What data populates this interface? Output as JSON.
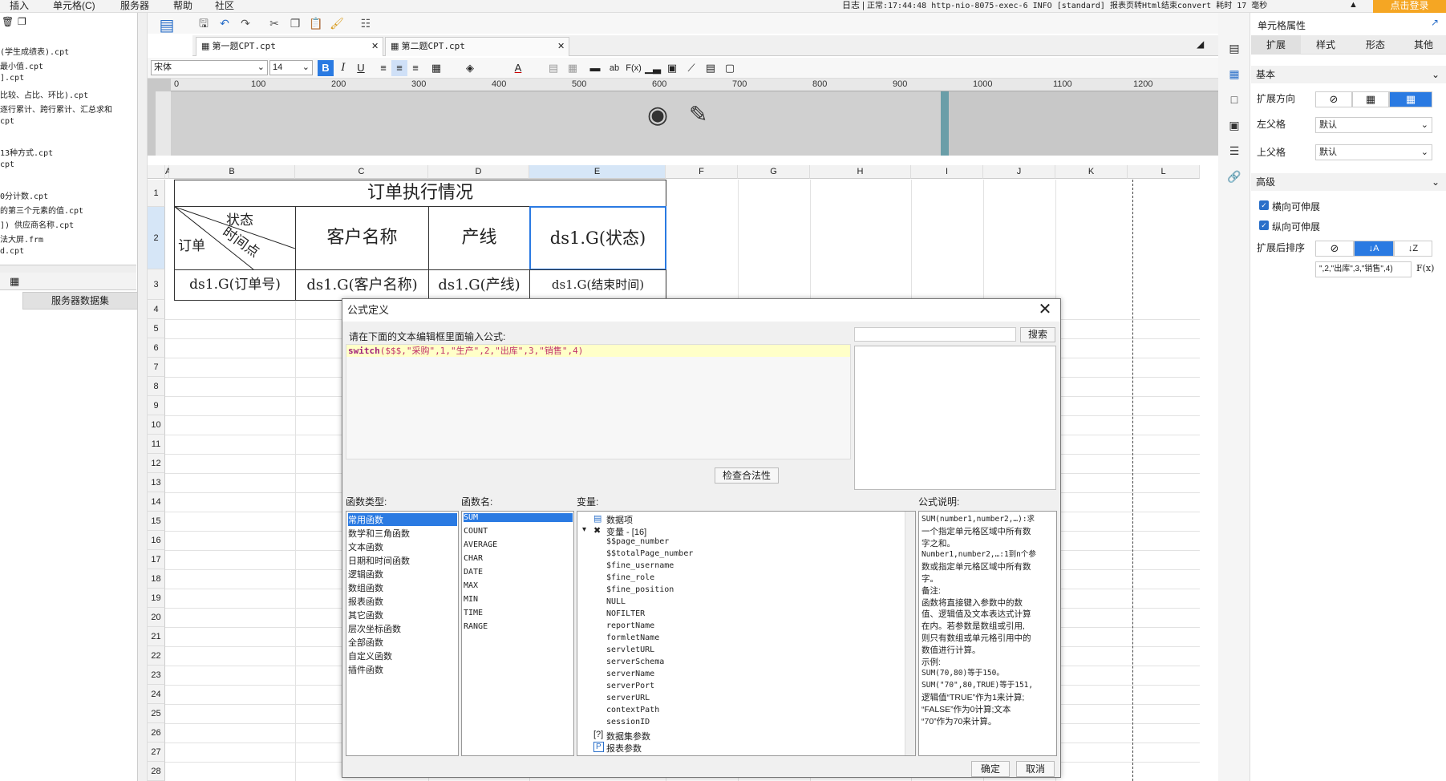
{
  "menu": {
    "items": [
      "插入",
      "单元格(C)",
      "服务器",
      "帮助",
      "社区"
    ]
  },
  "status": {
    "log_label": "日志",
    "log_text": "正常:17:44:48 http-nio-8075-exec-6 INFO [standard] 报表页转Html结束convert 耗时 17 毫秒",
    "login": "点击登录"
  },
  "left_panel": {
    "files": [
      "(学生成绩表).cpt",
      "最小值.cpt",
      "].cpt",
      "比较、占比、环比).cpt",
      "逐行累计、跨行累计、汇总求和",
      "cpt",
      "",
      "13种方式.cpt",
      "cpt",
      "",
      "0分计数.cpt",
      "的第三个元素的值.cpt",
      "]) 供应商名称.cpt",
      "法大屏.frm",
      "d.cpt"
    ],
    "datasource_button": "服务器数据集"
  },
  "tabs": [
    {
      "label": "第一题CPT.cpt"
    },
    {
      "label": "第二题CPT.cpt"
    }
  ],
  "format_toolbar": {
    "font": "宋体",
    "size": "14"
  },
  "ruler": [
    "0",
    "100",
    "200",
    "300",
    "400",
    "500",
    "600",
    "700",
    "800",
    "900",
    "1000",
    "1100",
    "1200"
  ],
  "columns": [
    "A",
    "B",
    "C",
    "D",
    "E",
    "F",
    "G",
    "H",
    "I",
    "J",
    "K",
    "L"
  ],
  "rows": [
    "1",
    "2",
    "3",
    "4",
    "5",
    "6",
    "7",
    "8",
    "9",
    "10",
    "11",
    "12",
    "13",
    "14",
    "15",
    "16",
    "17",
    "18",
    "19",
    "20",
    "21",
    "22",
    "23",
    "24",
    "25",
    "26",
    "27",
    "28"
  ],
  "report": {
    "title": "订单执行情况",
    "diag_state": "状态",
    "diag_time": "时间点",
    "diag_order": "订单",
    "h_customer": "客户名称",
    "h_line": "产线",
    "h_state": "ds1.G(状态)",
    "r_order": "ds1.G(订单号)",
    "r_customer": "ds1.G(客户名称)",
    "r_line": "ds1.G(产线)",
    "r_end": "ds1.G(结束时间)"
  },
  "right_panel": {
    "title": "单元格属性",
    "tabs": [
      "扩展",
      "样式",
      "形态",
      "其他"
    ],
    "basic": "基本",
    "expand_dir": "扩展方向",
    "left_parent": "左父格",
    "left_parent_val": "默认",
    "up_parent": "上父格",
    "up_parent_val": "默认",
    "advanced": "高级",
    "h_expand": "横向可伸展",
    "v_expand": "纵向可伸展",
    "sort_after": "扩展后排序",
    "formula_preview": "\",2,\"出库\",3,\"销售\",4)",
    "fx": "F(x)"
  },
  "dialog": {
    "title": "公式定义",
    "prompt": "请在下面的文本编辑框里面输入公式:",
    "fn_name": "switch",
    "formula_rest": "($$$,\"采购\",1,\"生产\",2,\"出库\",3,\"销售\",4)",
    "search_btn": "搜索",
    "check_btn": "检查合法性",
    "lbl_types": "函数类型:",
    "lbl_names": "函数名:",
    "lbl_vars": "变量:",
    "lbl_desc": "公式说明:",
    "types": [
      "常用函数",
      "数学和三角函数",
      "文本函数",
      "日期和时间函数",
      "逻辑函数",
      "数组函数",
      "报表函数",
      "其它函数",
      "层次坐标函数",
      "全部函数",
      "自定义函数",
      "插件函数"
    ],
    "names": [
      "SUM",
      "COUNT",
      "AVERAGE",
      "CHAR",
      "DATE",
      "MAX",
      "MIN",
      "TIME",
      "RANGE"
    ],
    "var_dataitem": "数据项",
    "var_group": "变量 - [16]",
    "vars": [
      "$$page_number",
      "$$totalPage_number",
      "$fine_username",
      "$fine_role",
      "$fine_position",
      "NULL",
      "NOFILTER",
      "reportName",
      "formletName",
      "servletURL",
      "serverSchema",
      "serverName",
      "serverPort",
      "serverURL",
      "contextPath",
      "sessionID"
    ],
    "var_dsparam": "数据集参数",
    "var_reportparam": "报表参数",
    "desc": [
      "SUM(number1,number2,…):求",
      "一个指定单元格区域中所有数",
      "字之和。",
      "Number1,number2,…:1到n个参",
      "数或指定单元格区域中所有数",
      "字。",
      "备注:",
      "函数将直接键入参数中的数",
      "值、逻辑值及文本表达式计算",
      "在内。若参数是数组或引用,",
      "则只有数组或单元格引用中的",
      "数值进行计算。",
      "示例:",
      "SUM(70,80)等于150。",
      "SUM(\"70\",80,TRUE)等于151,",
      "逻辑值“TRUE”作为1来计算;",
      "“FALSE”作为0计算;文本",
      "“70”作为70来计算。"
    ],
    "ok": "确定",
    "cancel": "取消"
  }
}
